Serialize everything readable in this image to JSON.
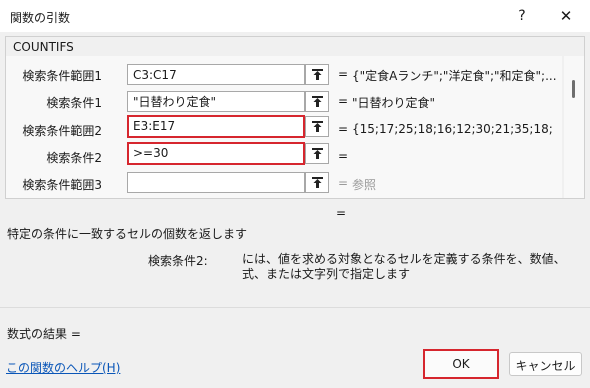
{
  "window": {
    "title": "関数の引数",
    "help_glyph": "?",
    "close_glyph": "✕"
  },
  "function_name": "COUNTIFS",
  "rows": [
    {
      "label": "検索条件範囲1",
      "input": "C3:C17",
      "equals": "=",
      "value": "{\"定食Aランチ\";\"洋定食\";\"和定食\";...",
      "highlight": false
    },
    {
      "label": "検索条件1",
      "input": "\"日替わり定食\"",
      "equals": "=",
      "value": "\"日替わり定食\"",
      "highlight": false
    },
    {
      "label": "検索条件範囲2",
      "input": "E3:E17",
      "equals": "=",
      "value": "{15;17;25;18;16;12;30;21;35;18;",
      "highlight": true
    },
    {
      "label": "検索条件2",
      "input": ">=30",
      "equals": "=",
      "value": "",
      "highlight": true
    },
    {
      "label": "検索条件範囲3",
      "input": "",
      "equals": "=",
      "value": "参照",
      "highlight": false
    }
  ],
  "result_equals": "=",
  "description": "特定の条件に一致するセルの個数を返します",
  "param_help": {
    "name": "検索条件2:",
    "text": "には、値を求める対象となるセルを定義する条件を、数値、式、または文字列で指定します"
  },
  "formula_result_label": "数式の結果 =",
  "help_link": "この関数のヘルプ(H)",
  "buttons": {
    "ok": "OK",
    "cancel": "キャンセル"
  },
  "colors": {
    "highlight": "#d6262e",
    "link": "#0a56b8"
  }
}
